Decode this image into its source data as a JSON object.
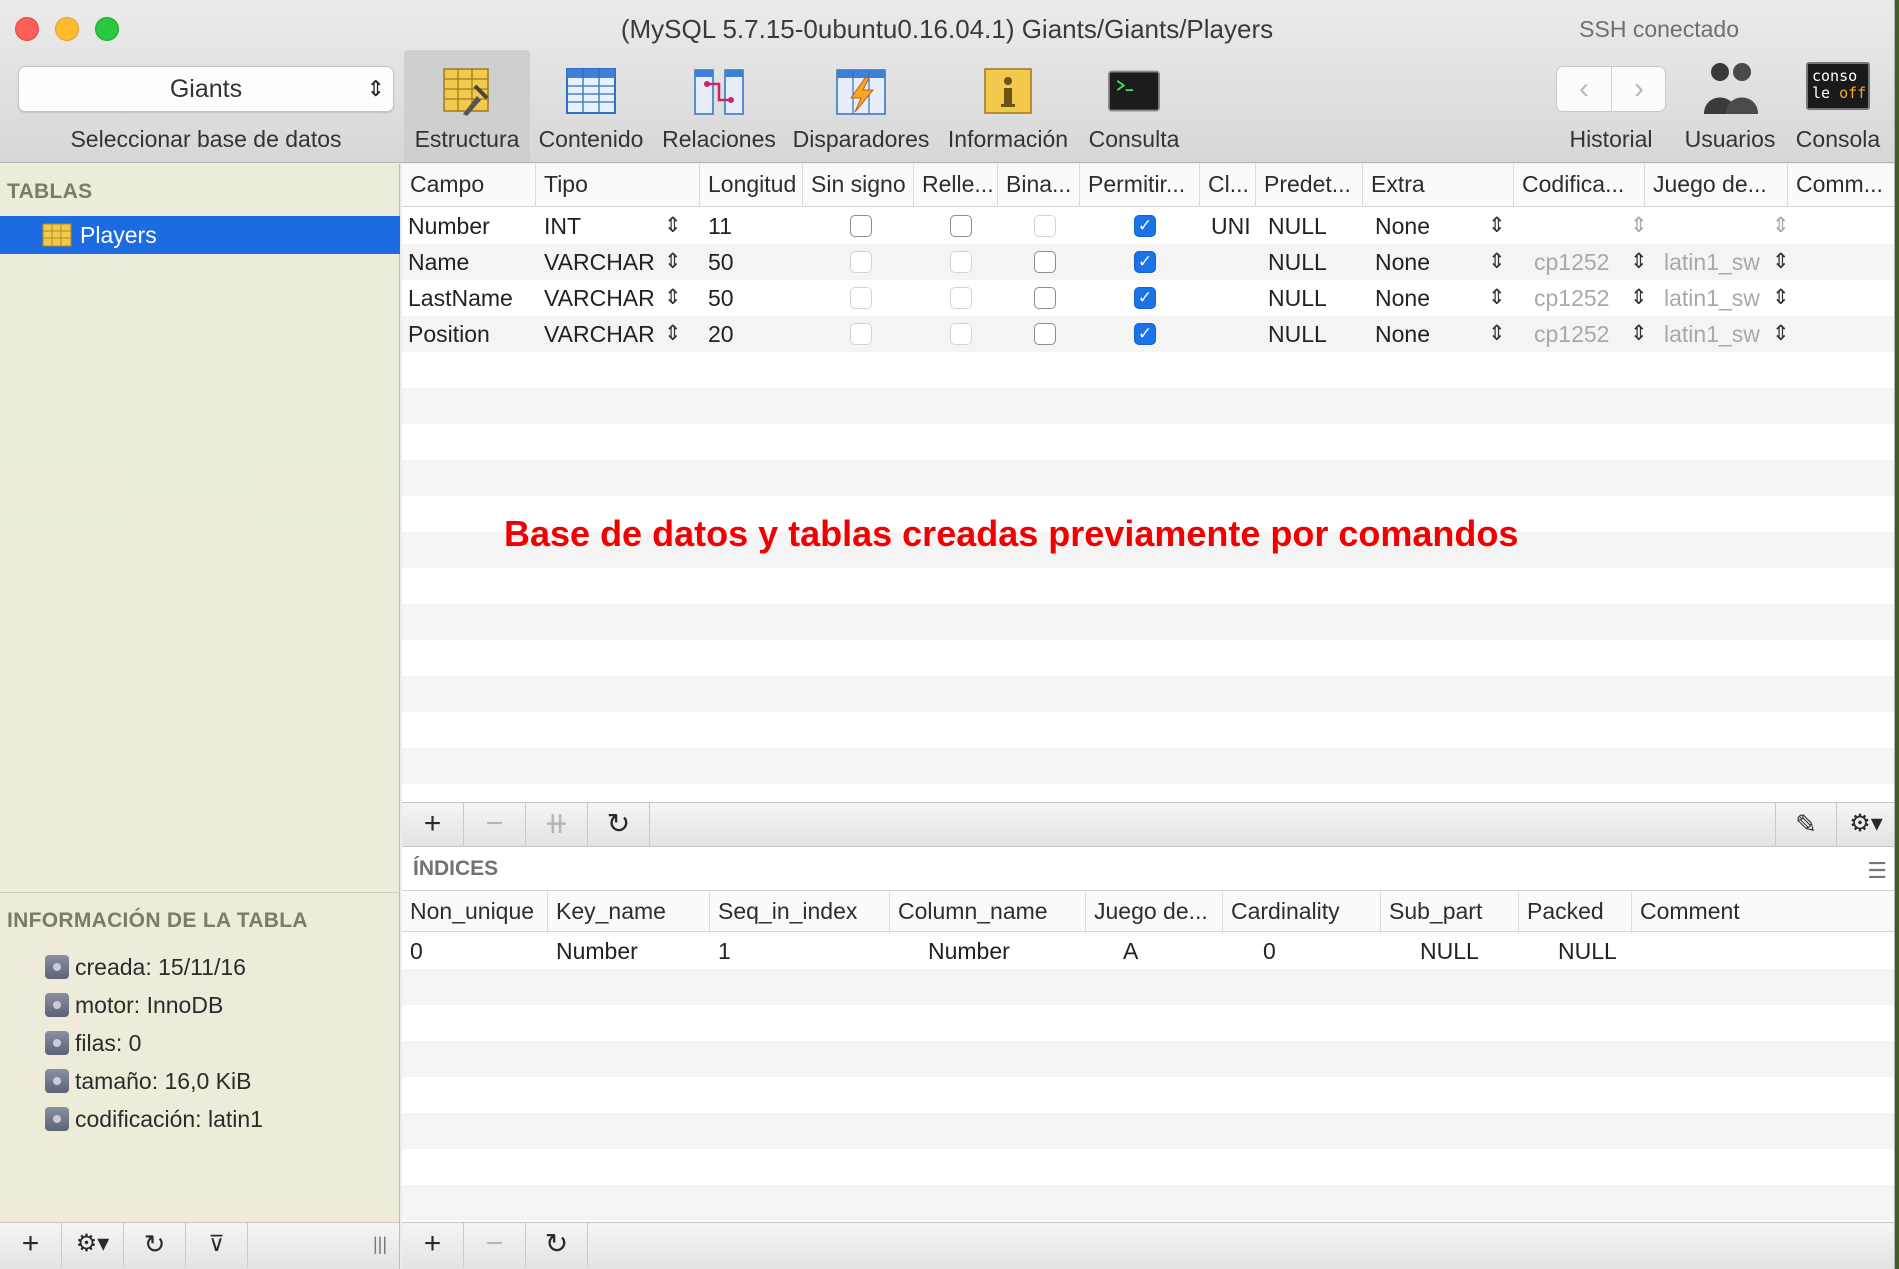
{
  "window": {
    "title": "(MySQL 5.7.15-0ubuntu0.16.04.1) Giants/Giants/Players",
    "ssh_status": "SSH conectado"
  },
  "toolbar": {
    "db_select_value": "Giants",
    "db_select_label": "Seleccionar base de datos",
    "buttons": [
      {
        "label": "Estructura",
        "icon": "structure-icon",
        "active": true
      },
      {
        "label": "Contenido",
        "icon": "table-content-icon",
        "active": false
      },
      {
        "label": "Relaciones",
        "icon": "relations-icon",
        "active": false
      },
      {
        "label": "Disparadores",
        "icon": "triggers-icon",
        "active": false
      },
      {
        "label": "Información",
        "icon": "info-icon",
        "active": false
      },
      {
        "label": "Consulta",
        "icon": "terminal-icon",
        "active": false
      }
    ],
    "historial": "Historial",
    "usuarios": "Usuarios",
    "consola": "Consola",
    "consola_badge_1": "conso",
    "consola_badge_2": "le",
    "consola_badge_3": "off"
  },
  "sidebar": {
    "tables_header": "TABLAS",
    "tables": [
      "Players"
    ],
    "info_header": "INFORMACIÓN DE LA TABLA",
    "info": [
      "creada: 15/11/16",
      "motor: InnoDB",
      "filas: 0",
      "tamaño: 16,0 KiB",
      "codificación: latin1"
    ]
  },
  "structure": {
    "columns": [
      "Campo",
      "Tipo",
      "Longitud",
      "Sin signo",
      "Relle...",
      "Bina...",
      "Permitir...",
      "Cl...",
      "Predet...",
      "Extra",
      "Codifica...",
      "Juego de...",
      "Comm..."
    ],
    "rows": [
      {
        "campo": "Number",
        "tipo": "INT",
        "longitud": "11",
        "clave": "UNI",
        "predet": "NULL",
        "extra": "None",
        "codif": "",
        "juego": ""
      },
      {
        "campo": "Name",
        "tipo": "VARCHAR",
        "longitud": "50",
        "clave": "",
        "predet": "NULL",
        "extra": "None",
        "codif": "cp1252",
        "juego": "latin1_sw"
      },
      {
        "campo": "LastName",
        "tipo": "VARCHAR",
        "longitud": "50",
        "clave": "",
        "predet": "NULL",
        "extra": "None",
        "codif": "cp1252",
        "juego": "latin1_sw"
      },
      {
        "campo": "Position",
        "tipo": "VARCHAR",
        "longitud": "20",
        "clave": "",
        "predet": "NULL",
        "extra": "None",
        "codif": "cp1252",
        "juego": "latin1_sw"
      }
    ],
    "annotation": "Base de datos y tablas creadas previamente por comandos"
  },
  "indices": {
    "title": "ÍNDICES",
    "columns": [
      "Non_unique",
      "Key_name",
      "Seq_in_index",
      "Column_name",
      "Juego de...",
      "Cardinality",
      "Sub_part",
      "Packed",
      "Comment"
    ],
    "rows": [
      [
        "0",
        "Number",
        "1",
        "Number",
        "A",
        "0",
        "NULL",
        "NULL",
        ""
      ]
    ]
  },
  "colors": {
    "selection": "#1c6be0",
    "annotation": "#f00000",
    "checkbox_on": "#1a73e8"
  }
}
